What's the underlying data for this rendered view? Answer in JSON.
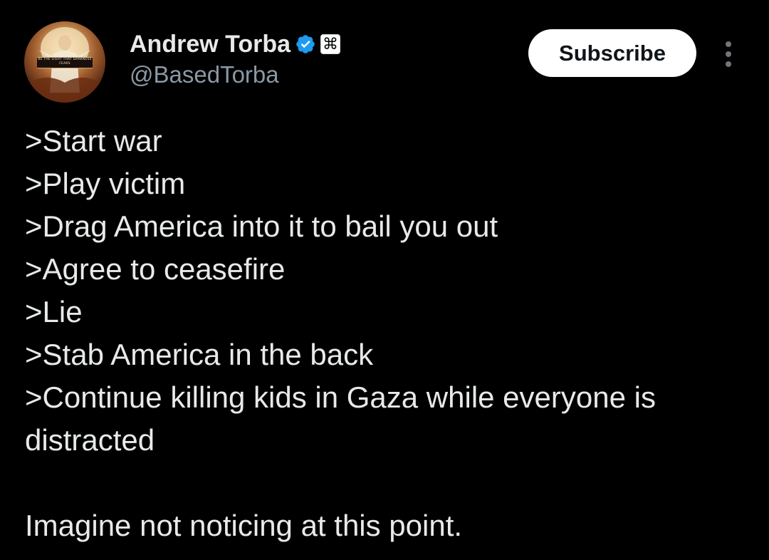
{
  "header": {
    "display_name": "Andrew Torba",
    "handle": "@BasedTorba",
    "avatar_text": "BE THE LIGHT THAT DARKNESS FEARS",
    "verified_icon": "verified-badge-icon",
    "affiliate_icon": "command-key-icon",
    "affiliate_glyph": "⌘",
    "subscribe_label": "Subscribe",
    "more_icon": "more-options-icon"
  },
  "tweet": {
    "lines": [
      ">Start war",
      ">Play victim",
      ">Drag America into it to bail you out",
      ">Agree to ceasefire",
      ">Lie",
      ">Stab America in the back",
      ">Continue killing kids in Gaza while everyone is",
      "distracted"
    ],
    "closing": "Imagine not noticing at this point."
  },
  "colors": {
    "background": "#000000",
    "text": "#e7e9ea",
    "secondary_text": "#8b98a5",
    "verified_blue": "#1d9bf0",
    "button_bg": "#ffffff"
  }
}
